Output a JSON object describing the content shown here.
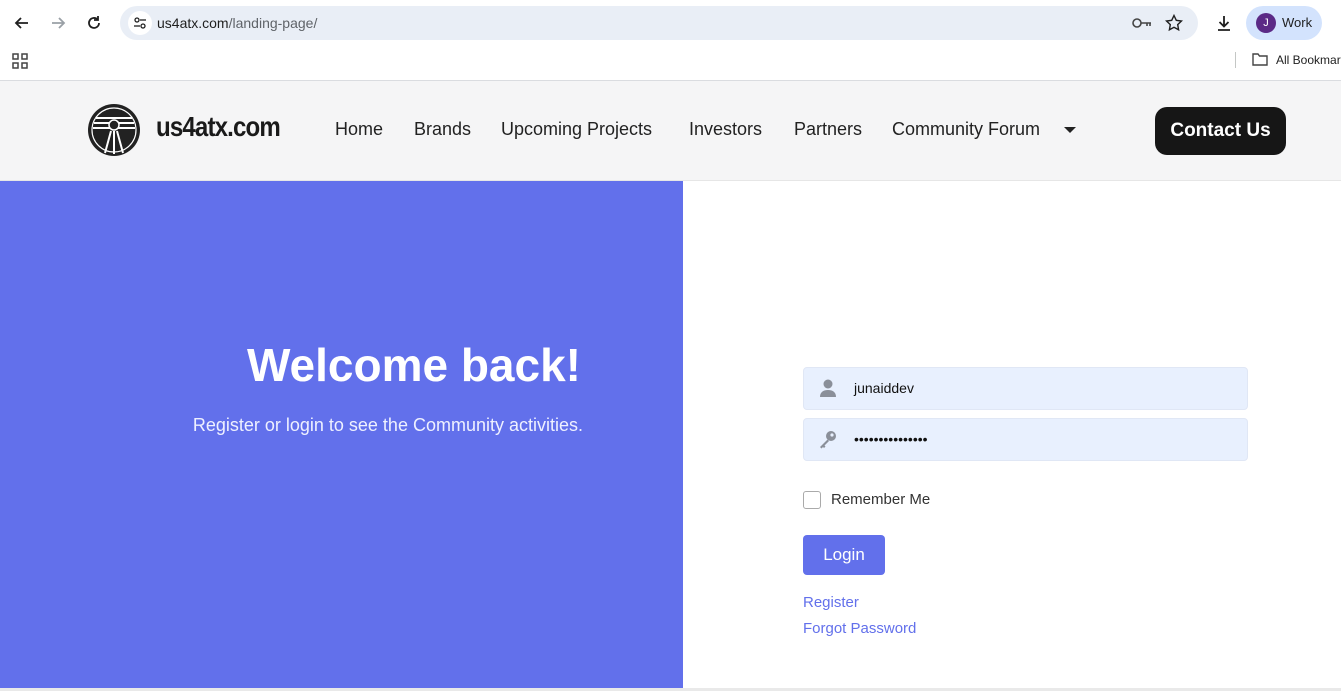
{
  "browser": {
    "url_host": "us4atx.com",
    "url_path": "/landing-page/",
    "profile_initial": "J",
    "profile_label": "Work",
    "bookmarks_label": "All Bookmar"
  },
  "site": {
    "logo_text": "us4atx.com",
    "nav": [
      "Home",
      "Brands",
      "Upcoming Projects",
      "Investors",
      "Partners",
      "Community Forum"
    ],
    "contact_label": "Contact Us"
  },
  "hero": {
    "title": "Welcome back!",
    "subtitle": "Register or login to see the Community activities."
  },
  "login": {
    "username": "junaiddev",
    "password_mask": "•••••••••••••••",
    "remember_label": "Remember Me",
    "login_label": "Login",
    "register_label": "Register",
    "forgot_label": "Forgot Password"
  },
  "colors": {
    "accent": "#6270eb",
    "dark_button": "#161616"
  }
}
